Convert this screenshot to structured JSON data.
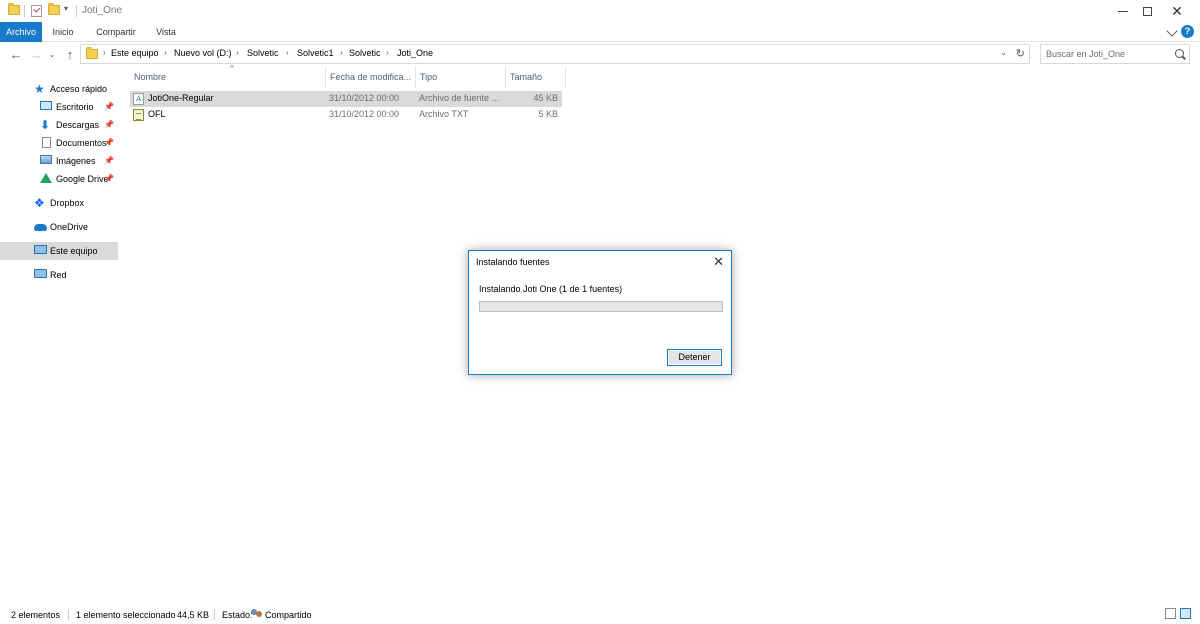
{
  "window": {
    "title": "Joti_One"
  },
  "ribbon": {
    "tabs": [
      {
        "label": "Archivo"
      },
      {
        "label": "Inicio"
      },
      {
        "label": "Compartir"
      },
      {
        "label": "Vista"
      }
    ],
    "accent_color": "#1979ca"
  },
  "address": {
    "crumbs": [
      "Este equipo",
      "Nuevo vol (D:)",
      "Solvetic",
      "Solvetic1",
      "Solvetic",
      "Joti_One"
    ],
    "search_placeholder": "Buscar en Joti_One"
  },
  "nav": {
    "items": [
      {
        "label": "Acceso rápido",
        "icon": "star-icon"
      },
      {
        "label": "Escritorio",
        "icon": "desktop-icon"
      },
      {
        "label": "Descargas",
        "icon": "download-icon"
      },
      {
        "label": "Documentos",
        "icon": "documents-icon"
      },
      {
        "label": "Imágenes",
        "icon": "pictures-icon"
      },
      {
        "label": "Google Drive",
        "icon": "google-drive-icon"
      },
      {
        "label": "Dropbox",
        "icon": "dropbox-icon"
      },
      {
        "label": "OneDrive",
        "icon": "onedrive-icon"
      },
      {
        "label": "Este equipo",
        "icon": "this-pc-icon"
      },
      {
        "label": "Red",
        "icon": "network-icon"
      }
    ]
  },
  "columns": [
    "Nombre",
    "Fecha de modifica...",
    "Tipo",
    "Tamaño"
  ],
  "files": [
    {
      "name": "JotiOne-Regular",
      "date": "31/10/2012 00:00",
      "type": "Archivo de fuente ...",
      "size": "45 KB",
      "icon": "font-file-icon"
    },
    {
      "name": "OFL",
      "date": "31/10/2012 00:00",
      "type": "Archivo TXT",
      "size": "5 KB",
      "icon": "text-file-icon"
    }
  ],
  "dialog": {
    "title": "Instalando fuentes",
    "status": "Instalando Joti One (1 de 1 fuentes)",
    "progress": 0,
    "stop_label": "Detener"
  },
  "statusbar": {
    "count": "2 elementos",
    "selection": "1 elemento seleccionado",
    "size": "44,5 KB",
    "state_label": "Estado:",
    "state_value": "Compartido"
  }
}
